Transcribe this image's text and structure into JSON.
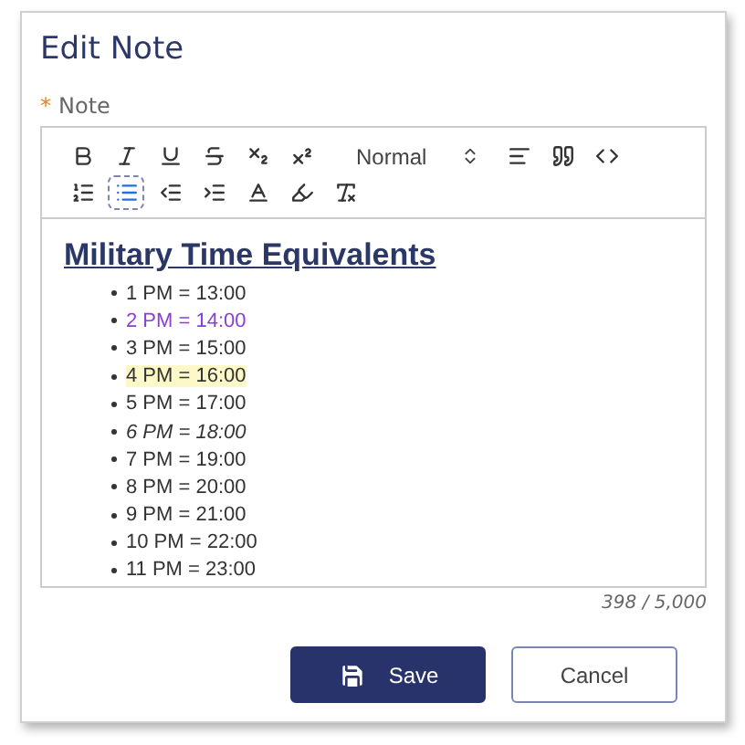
{
  "dialog": {
    "title": "Edit Note"
  },
  "field": {
    "required_mark": "*",
    "label": "Note"
  },
  "toolbar": {
    "rows": [
      [
        {
          "kind": "bold",
          "selected": false
        },
        {
          "kind": "italic",
          "selected": false
        },
        {
          "kind": "underline",
          "selected": false
        },
        {
          "kind": "strike",
          "selected": false
        },
        {
          "kind": "subscript",
          "selected": false
        },
        {
          "kind": "superscript",
          "selected": false
        },
        {
          "kind": "format",
          "label": "Normal"
        },
        {
          "kind": "align",
          "selected": false
        },
        {
          "kind": "quote",
          "selected": false
        },
        {
          "kind": "code",
          "selected": false
        }
      ],
      [
        {
          "kind": "ordered-list",
          "selected": false
        },
        {
          "kind": "bullet-list",
          "selected": true
        },
        {
          "kind": "outdent",
          "selected": false
        },
        {
          "kind": "indent",
          "selected": false
        },
        {
          "kind": "text-color",
          "selected": false
        },
        {
          "kind": "background",
          "selected": false
        },
        {
          "kind": "clear-format",
          "selected": false
        }
      ]
    ]
  },
  "content": {
    "heading": "Military Time Equivalents",
    "items": [
      {
        "text": "1 PM = 13:00",
        "highlighted": false,
        "italic": false
      },
      {
        "text": "2 PM = 14:00",
        "color": "#8a3fd1",
        "highlighted": false,
        "italic": false
      },
      {
        "text": "3 PM = 15:00",
        "highlighted": false,
        "italic": false
      },
      {
        "text": "4 PM = 16:00",
        "highlighted": true,
        "italic": false
      },
      {
        "text": "5 PM = 17:00",
        "highlighted": false,
        "italic": false
      },
      {
        "text": "6 PM = 18:00",
        "highlighted": false,
        "italic": true
      },
      {
        "text": "7 PM = 19:00",
        "highlighted": false,
        "italic": false
      },
      {
        "text": "8 PM = 20:00",
        "highlighted": false,
        "italic": false
      },
      {
        "text": "9 PM = 21:00",
        "highlighted": false,
        "italic": false
      },
      {
        "text": "10 PM = 22:00",
        "highlighted": false,
        "italic": false
      },
      {
        "text": "11 PM = 23:00",
        "highlighted": false,
        "italic": false
      }
    ]
  },
  "counter": "398 / 5,000",
  "buttons": [
    {
      "kind": "primary",
      "label": "Save"
    },
    {
      "kind": "secondary",
      "label": "Cancel"
    }
  ]
}
